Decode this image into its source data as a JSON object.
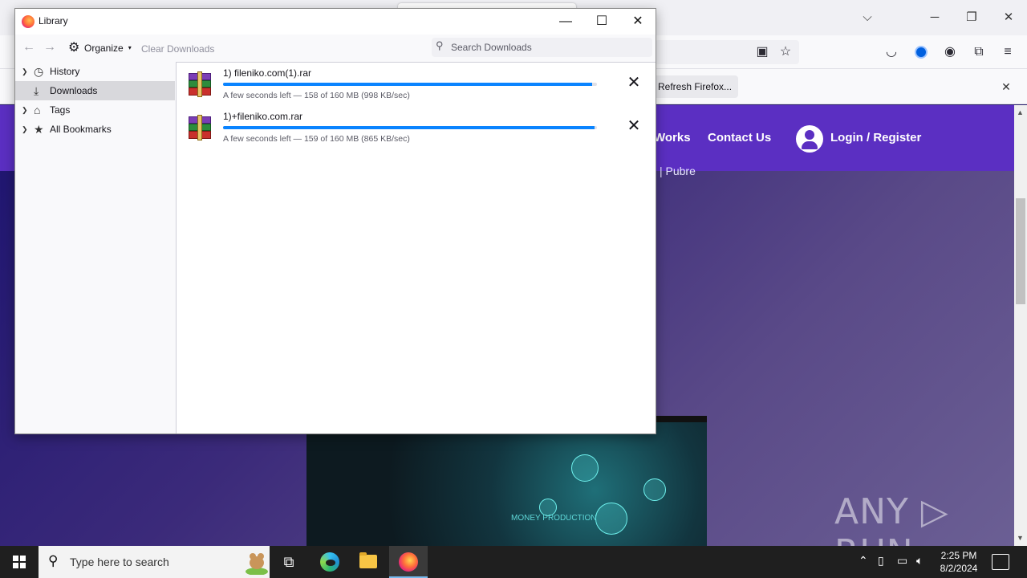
{
  "library": {
    "title": "Library",
    "controls": {
      "minimize": "—",
      "maximize": "☐",
      "close": "✕"
    },
    "toolbar": {
      "organize_label": "Organize",
      "clear_downloads_label": "Clear Downloads",
      "search_placeholder": "Search Downloads"
    },
    "sidebar": {
      "items": [
        {
          "label": "History",
          "icon": "clock-icon",
          "expandable": true,
          "selected": false
        },
        {
          "label": "Downloads",
          "icon": "download-icon",
          "expandable": false,
          "selected": true
        },
        {
          "label": "Tags",
          "icon": "tag-icon",
          "expandable": true,
          "selected": false
        },
        {
          "label": "All Bookmarks",
          "icon": "star-icon",
          "expandable": true,
          "selected": false
        }
      ]
    },
    "downloads": [
      {
        "name": "1) fileniko.com(1).rar",
        "status": "A few seconds left — 158 of 160 MB (998 KB/sec)",
        "progress": 0.9875
      },
      {
        "name": "1)+fileniko.com.rar",
        "status": "A few seconds left — 159 of 160 MB (865 KB/sec)",
        "progress": 0.99375
      }
    ]
  },
  "browser": {
    "notification": {
      "button_label": "Refresh Firefox..."
    },
    "site": {
      "nav_fragment": "Works",
      "contact_link": "Contact Us",
      "login_link": "Login / Register",
      "text_fragment": "| Pubre",
      "hero_text": "MONEY PRODUCTION"
    }
  },
  "watermark": "ANY ▷ RUN",
  "taskbar": {
    "search_placeholder": "Type here to search",
    "time": "2:25 PM",
    "date": "8/2/2024"
  },
  "colors": {
    "accent": "#0a84ff",
    "site_nav": "#5b2fc2",
    "selected_row": "#d8d8dc",
    "taskbar": "#1f1f1f"
  }
}
